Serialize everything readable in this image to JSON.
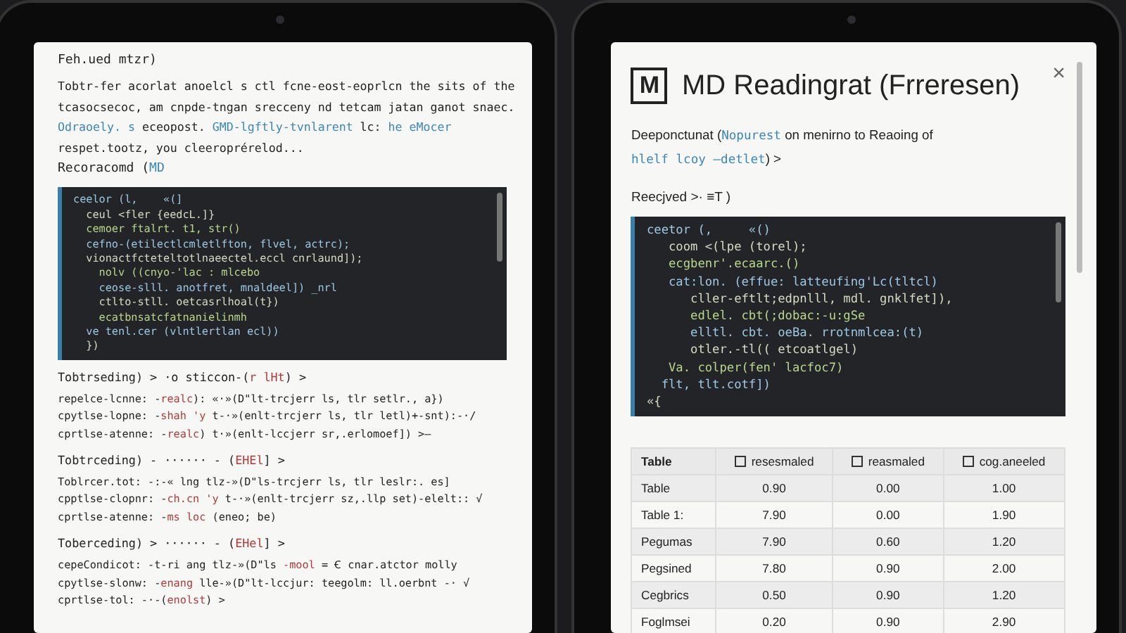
{
  "left_screen": {
    "heading": "Feh.ued mtzr)",
    "paragraph": [
      {
        "text": "Tobtr-fer acorlat anoelcl s ctl fcne-eost-eoprlcn the sits of the tcasocsecoc, am cnpde-tngan srecceny nd tetcam jatan ganot snaec. ",
        "link": false
      },
      {
        "text": "Odraoely. s",
        "link": true
      },
      {
        "text": " eceopost. ",
        "link": false
      },
      {
        "text": "GMD-lgftly-tvnlarent",
        "link": true
      },
      {
        "text": " lc: ",
        "link": false
      },
      {
        "text": "he eMocer",
        "link": true
      },
      {
        "text": " respet.tootz, you cleeroprérelod...",
        "link": false
      }
    ],
    "subheading": [
      {
        "text": "Recoracomd (",
        "link": false
      },
      {
        "text": "MD",
        "link": true
      }
    ],
    "code": [
      "ceelor (l,    «(]",
      "  ceul <fler {eedcL.]}",
      "  cemoer ftalrt. t1, str()",
      "  cefno-(etilectlcmletlfton, flvel, actrc);",
      "  vionactfcteteltotlnaeectel.eccl cnrlaund]);",
      "    nolv ((cnyo-'lac : mlcebo",
      "    ceose-slll. anotfret, mnaldeel]) _nrl",
      "    ctlto-stll. oetcasrlhoal(t})",
      "    ecatbnsatcfatnanielinmh",
      "  ve tenl.cer (vlntlertlan ecl))",
      "  })"
    ],
    "sections": [
      {
        "heading": [
          {
            "text": "Tobtrseding) > ·o sticcon-(",
            "accent": false
          },
          {
            "text": "r lHt",
            "accent": true
          },
          {
            "text": ") >",
            "accent": false
          }
        ],
        "lines": [
          [
            {
              "text": "repelce-lcnne: -",
              "accent": false
            },
            {
              "text": "realc",
              "accent": true
            },
            {
              "text": "): «·»(D\"lt-trcjerr ls, tlr setlr., a})",
              "accent": false
            }
          ],
          [
            {
              "text": "cpytlse-lopne: -",
              "accent": false
            },
            {
              "text": "shah 'y",
              "accent": true
            },
            {
              "text": " t-·»(enlt-trcjerr ls, tlr letl)+-snt):-·/",
              "accent": false
            }
          ],
          [
            {
              "text": "cprtlse-atenne: -",
              "accent": false
            },
            {
              "text": "realc",
              "accent": true
            },
            {
              "text": ") t·»(enlt-lccjerr sr,.erlomoef]) >—",
              "accent": false
            }
          ]
        ]
      },
      {
        "heading": [
          {
            "text": "Tobtrceding) - ······ - (",
            "accent": false
          },
          {
            "text": "EHEl",
            "accent": true
          },
          {
            "text": "] >",
            "accent": false
          }
        ],
        "lines": [
          [
            {
              "text": "Toblrcer.tot: -:-« lng tlz-»(D\"ls-trcjerr ls, tlr leslr:. es]",
              "accent": false
            }
          ],
          [
            {
              "text": "cpptlse-clopnr: -",
              "accent": false
            },
            {
              "text": "ch.cn 'y",
              "accent": true
            },
            {
              "text": " t-·»(enlt-trcjerr sz,.llp set)-elelt:: √",
              "accent": false
            }
          ],
          [
            {
              "text": "cprtlse-atenne: -",
              "accent": false
            },
            {
              "text": "ms loc",
              "accent": true
            },
            {
              "text": " (eneo; be)",
              "accent": false
            }
          ]
        ]
      },
      {
        "heading": [
          {
            "text": "Toberceding) > ······ - (",
            "accent": false
          },
          {
            "text": "EHel",
            "accent": true
          },
          {
            "text": "] >",
            "accent": false
          }
        ],
        "lines": [
          [
            {
              "text": "cepeCondicot: -t-ri ang tlz-»(D\"ls ",
              "accent": false
            },
            {
              "text": "-mool",
              "accent": true
            },
            {
              "text": " = Ꞓ cnar.atctor molly",
              "accent": false
            }
          ],
          [
            {
              "text": "cpytlse-slonw: -",
              "accent": false
            },
            {
              "text": "enang",
              "accent": true
            },
            {
              "text": " lle-»(D\"lt-lccjur: teegolm: ll.oerbnt -· √",
              "accent": false
            }
          ],
          [
            {
              "text": "cprtlse-tol: -·-(",
              "accent": false
            },
            {
              "text": "enolst",
              "accent": true
            },
            {
              "text": ") >",
              "accent": false
            }
          ]
        ]
      }
    ]
  },
  "right_screen": {
    "logo_letter": "M",
    "title": "MD Readingrat (Frreresen)",
    "close": "×",
    "description": [
      {
        "text": "Deeponctunat (",
        "link": false
      },
      {
        "text": "Nopurest",
        "link": true
      },
      {
        "text": " on menirno to Reaoing of ",
        "link": false
      },
      {
        "text": "hlelf lcoy –detlet",
        "link": true
      },
      {
        "text": ") >",
        "link": false
      }
    ],
    "sublabel": "Reecjved >· ≡T )",
    "code": [
      "ceetor (,     «()",
      "   coom <(lpe (torel);",
      "   ecgbenr'.ecaarc.()",
      "   cat:lon. (effue: latteufing'Lc(tltcl)",
      "      cller-eftlt;edpnlll, mdl. gnklfet]),",
      "      edlel. cbt(;dobac:-u:gSe",
      "      elltl. cbt. oeBa. rrotnmlcea:(t)",
      "      otler.-tl(( etcoatlgel)",
      "   Va. colper(fen' lacfoc7)",
      "  flt, tlt.cotf])",
      "«{"
    ],
    "table": {
      "columns": [
        {
          "label": "Table",
          "checkbox": false
        },
        {
          "label": "resesmaled",
          "checkbox": true
        },
        {
          "label": "reasmaled",
          "checkbox": true
        },
        {
          "label": "cog.aneeled",
          "checkbox": true
        }
      ],
      "rows": [
        [
          "Table",
          "0.90",
          "0.00",
          "1.00"
        ],
        [
          "Table 1:",
          "7.90",
          "0.00",
          "1.90"
        ],
        [
          "Pegumas",
          "7.90",
          "0.60",
          "1.20"
        ],
        [
          "Pegsined",
          "7.80",
          "0.90",
          "2.00"
        ],
        [
          "Cegbrics",
          "0.50",
          "0.90",
          "1.20"
        ],
        [
          "Foglmsei",
          "0.20",
          "0.90",
          "2.90"
        ]
      ]
    }
  }
}
